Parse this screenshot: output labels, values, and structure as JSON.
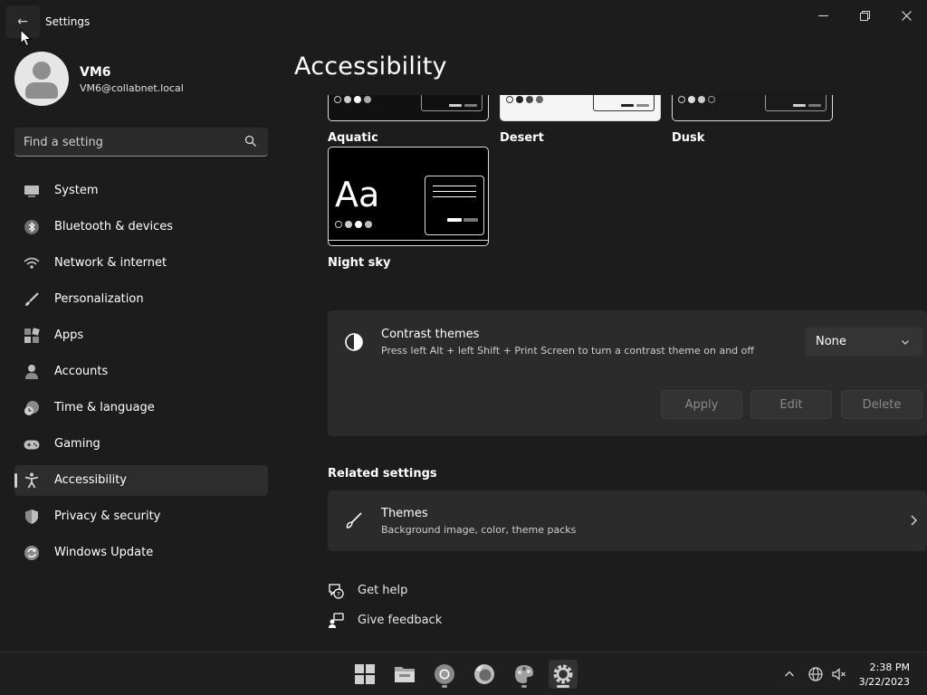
{
  "window": {
    "title": "Settings",
    "back_glyph": "←",
    "controls": [
      "minimize-icon",
      "restore-icon",
      "close-icon"
    ]
  },
  "user": {
    "name": "VM6",
    "email": "VM6@collabnet.local"
  },
  "search": {
    "placeholder": "Find a setting",
    "icon": "search-icon"
  },
  "nav": {
    "items": [
      {
        "label": "System",
        "icon": "system-icon",
        "active": false
      },
      {
        "label": "Bluetooth & devices",
        "icon": "bluetooth-icon",
        "active": false
      },
      {
        "label": "Network & internet",
        "icon": "wifi-icon",
        "active": false
      },
      {
        "label": "Personalization",
        "icon": "brush-icon",
        "active": false
      },
      {
        "label": "Apps",
        "icon": "apps-icon",
        "active": false
      },
      {
        "label": "Accounts",
        "icon": "person-icon",
        "active": false
      },
      {
        "label": "Time & language",
        "icon": "clock-globe-icon",
        "active": false
      },
      {
        "label": "Gaming",
        "icon": "gamepad-icon",
        "active": false
      },
      {
        "label": "Accessibility",
        "icon": "accessibility-icon",
        "active": true
      },
      {
        "label": "Privacy & security",
        "icon": "shield-icon",
        "active": false
      },
      {
        "label": "Windows Update",
        "icon": "update-icon",
        "active": false
      }
    ]
  },
  "main": {
    "title": "Accessibility",
    "themes": [
      {
        "name": "Aquatic"
      },
      {
        "name": "Desert"
      },
      {
        "name": "Dusk"
      },
      {
        "name": "Night sky",
        "preview_text": "Aa"
      }
    ],
    "contrast": {
      "title": "Contrast themes",
      "subtitle": "Press left Alt + left Shift + Print Screen to turn a contrast theme on and off",
      "dropdown_value": "None",
      "buttons": {
        "apply": "Apply",
        "edit": "Edit",
        "delete": "Delete"
      }
    },
    "related": {
      "heading": "Related settings",
      "themes_title": "Themes",
      "themes_subtitle": "Background image, color, theme packs"
    },
    "links": {
      "help": "Get help",
      "feedback": "Give feedback"
    }
  },
  "taskbar": {
    "apps": [
      "start-icon",
      "file-explorer-icon",
      "chrome-icon",
      "firefox-icon",
      "paint-icon",
      "settings-icon"
    ],
    "time": "2:38 PM",
    "date": "3/22/2023"
  },
  "colors": {
    "background": "#1c1c1c",
    "card": "#2b2b2b",
    "text": "#ffffff",
    "muted": "#cfcfcf",
    "disabled_text": "#8a8a8a"
  }
}
